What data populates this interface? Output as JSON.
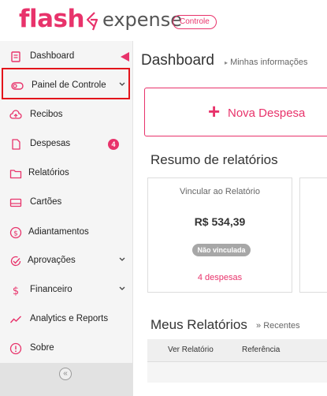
{
  "brand": {
    "name_part1": "flash",
    "name_part2": "expense",
    "badge": "Controle",
    "accent_color": "#e8336b"
  },
  "sidebar": {
    "items": [
      {
        "label": "Dashboard",
        "icon": "dashboard-icon",
        "active": true
      },
      {
        "label": "Painel de Controle",
        "icon": "control-panel-icon",
        "expandable": true
      },
      {
        "label": "Recibos",
        "icon": "upload-cloud-icon"
      },
      {
        "label": "Despesas",
        "icon": "document-icon",
        "badge": "4"
      },
      {
        "label": "Relatórios",
        "icon": "folder-icon"
      },
      {
        "label": "Cartões",
        "icon": "card-icon"
      },
      {
        "label": "Adiantamentos",
        "icon": "dollar-circle-icon"
      },
      {
        "label": "Aprovações",
        "icon": "check-circle-icon",
        "expandable": true
      },
      {
        "label": "Financeiro",
        "icon": "dollar-icon",
        "expandable": true
      },
      {
        "label": "Analytics e Reports",
        "icon": "trend-icon"
      },
      {
        "label": "Sobre",
        "icon": "info-icon"
      }
    ],
    "collapse_symbol": "«"
  },
  "main": {
    "title": "Dashboard",
    "breadcrumb": "Minhas informações",
    "new_expense_label": "Nova Despesa",
    "summary_title": "Resumo de relatórios",
    "card": {
      "title": "Vincular ao Relatório",
      "amount": "R$ 534,39",
      "status": "Não vinculada",
      "link": "4 despesas"
    },
    "reports_title": "Meus Relatórios",
    "reports_subtitle": "Recentes",
    "table_headers": [
      "Ver Relatório",
      "Referência"
    ]
  }
}
